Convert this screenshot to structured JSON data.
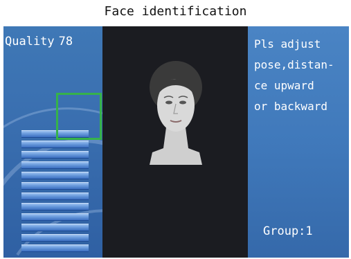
{
  "header": {
    "title": "Face identification"
  },
  "quality": {
    "label": "Quality",
    "value": "78",
    "bar_count": 12
  },
  "hint": {
    "lines": [
      "Pls adjust",
      "pose,distan-",
      "ce upward",
      "or backward"
    ]
  },
  "group": {
    "text": "Group:1"
  },
  "colors": {
    "face_box": "#36b24a",
    "panel_blue": "#3f78b6",
    "camera_bg": "#1b1c21"
  },
  "icons": {
    "face_frame": "face-detection-box"
  }
}
